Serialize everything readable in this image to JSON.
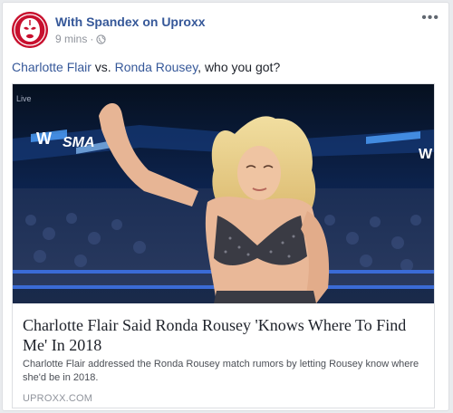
{
  "post": {
    "page_name": "With Spandex on Uproxx",
    "timestamp": "9 mins",
    "separator": "·",
    "privacy_icon": "globe-icon",
    "more_icon": "more-options-icon",
    "avatar_icon": "luchador-mask-logo"
  },
  "message": {
    "name1": "Charlotte Flair",
    "vs": " vs. ",
    "name2": "Ronda Rousey",
    "rest": ", who you got?"
  },
  "link": {
    "live_label": "Live",
    "title": "Charlotte Flair Said Ronda Rousey 'Knows Where To Find Me' In 2018",
    "description": "Charlotte Flair addressed the Ronda Rousey match rumors by letting Rousey know where she'd be in 2018.",
    "domain": "UPROXX.COM"
  },
  "colors": {
    "page_name": "#365899",
    "avatar_red": "#c8102e",
    "meta_gray": "#90949c"
  }
}
